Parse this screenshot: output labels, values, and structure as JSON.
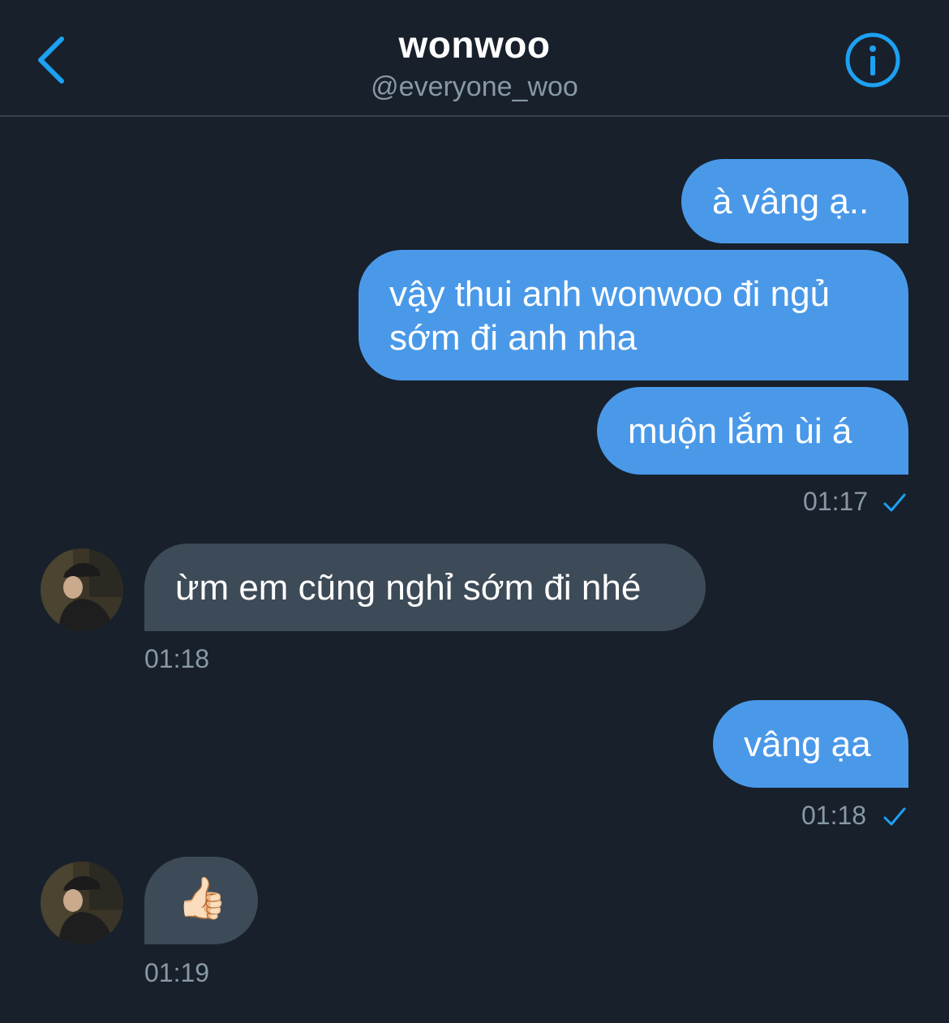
{
  "header": {
    "name": "wonwoo",
    "handle": "@everyone_woo",
    "back_icon": "chevron-left-icon",
    "info_icon": "info-icon"
  },
  "colors": {
    "background": "#18202b",
    "outgoing_bubble": "#4a99e9",
    "incoming_bubble": "#3d4a57",
    "accent": "#1da1f2",
    "timestamp": "#8899a6"
  },
  "messages": {
    "m1": "à vâng ạ..",
    "m2_line1": "vậy thui anh wonwoo đi ngủ",
    "m2_line2": "sớm đi anh nha",
    "m3": "muộn lắm ùi á",
    "t1": "01:17",
    "m4": "ừm em cũng nghỉ sớm đi nhé",
    "t2": "01:18",
    "m5": "vâng ạa",
    "t3": "01:18",
    "m6": "👍🏻",
    "t4": "01:19"
  }
}
